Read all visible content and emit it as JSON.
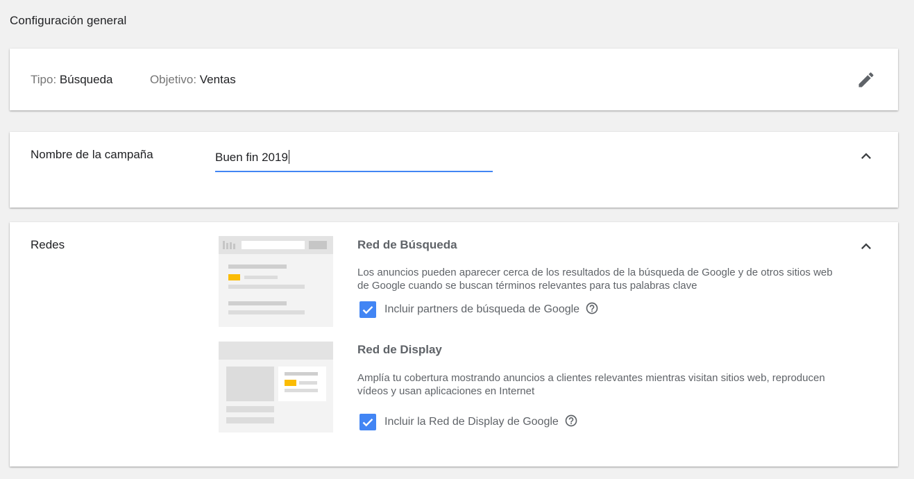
{
  "page": {
    "title": "Configuración general"
  },
  "summary": {
    "type_label": "Tipo:",
    "type_value": "Búsqueda",
    "goal_label": "Objetivo:",
    "goal_value": "Ventas",
    "edit_icon": "pencil-icon"
  },
  "campaign_name": {
    "label": "Nombre de la campaña",
    "value": "Buen fin 2019",
    "toggle_icon": "chevron-up-icon"
  },
  "networks": {
    "label": "Redes",
    "toggle_icon": "chevron-up-icon",
    "search_network": {
      "title": "Red de Búsqueda",
      "description": "Los anuncios pueden aparecer cerca de los resultados de la búsqueda de Google y de otros sitios web de Google cuando se buscan términos relevantes para tus palabras clave",
      "checkbox_label": "Incluir partners de búsqueda de Google",
      "checked": true
    },
    "display_network": {
      "title": "Red de Display",
      "description": "Amplía tu cobertura mostrando anuncios a clientes relevantes mientras visitan sitios web, reproducen vídeos y usan aplicaciones en Internet",
      "checkbox_label": "Incluir la Red de Display de Google",
      "checked": true
    }
  },
  "colors": {
    "background": "#f1f1f1",
    "card": "#ffffff",
    "accent": "#4285f4",
    "ad_highlight": "#fbbc04",
    "muted_text": "#5f6368"
  }
}
